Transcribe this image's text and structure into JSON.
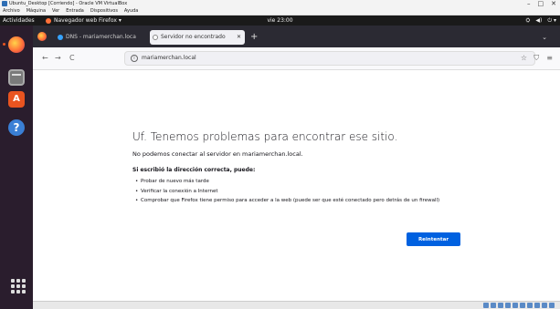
{
  "host": {
    "title": "Ubuntu_Desktop [Corriendo] - Oracle VM VirtualBox",
    "window_buttons": [
      "–",
      "□",
      "✕"
    ],
    "menu": [
      "Archivo",
      "Máquina",
      "Ver",
      "Entrada",
      "Dispositivos",
      "Ayuda"
    ]
  },
  "gnome": {
    "activities": "Actividades",
    "app_name": "Navegador web Firefox ▾",
    "clock": "vie 23:00",
    "tray": [
      "⛭",
      "◀)",
      "⏻ ▾"
    ]
  },
  "browser": {
    "tabs": [
      {
        "label": "DNS - mariamerchan.loca",
        "close": "✕"
      },
      {
        "label": "Servidor no encontrado",
        "close": "✕"
      }
    ],
    "new_tab": "+",
    "tab_list": "⌄",
    "nav": {
      "back": "←",
      "forward": "→",
      "reload": "C"
    },
    "url": "mariamerchan.local",
    "url_icon": "i",
    "bookmark_star": "☆",
    "toolbar_right": [
      "⛉",
      "≡"
    ]
  },
  "error_page": {
    "title": "Uf. Tenemos problemas para encontrar ese sitio.",
    "description": "No podemos conectar al servidor en mariamerchan.local.",
    "hint_heading": "Si escribió la dirección correcta, puede:",
    "suggestions": [
      "Probar de nuevo más tarde",
      "Verificar la conexión a Internet",
      "Comprobar que Firefox tiene permiso para acceder a la web (puede ser que esté conectado pero detrás de un firewall)"
    ],
    "retry_label": "Reintentar"
  },
  "dock": {
    "software_letter": "A",
    "help_symbol": "?"
  }
}
